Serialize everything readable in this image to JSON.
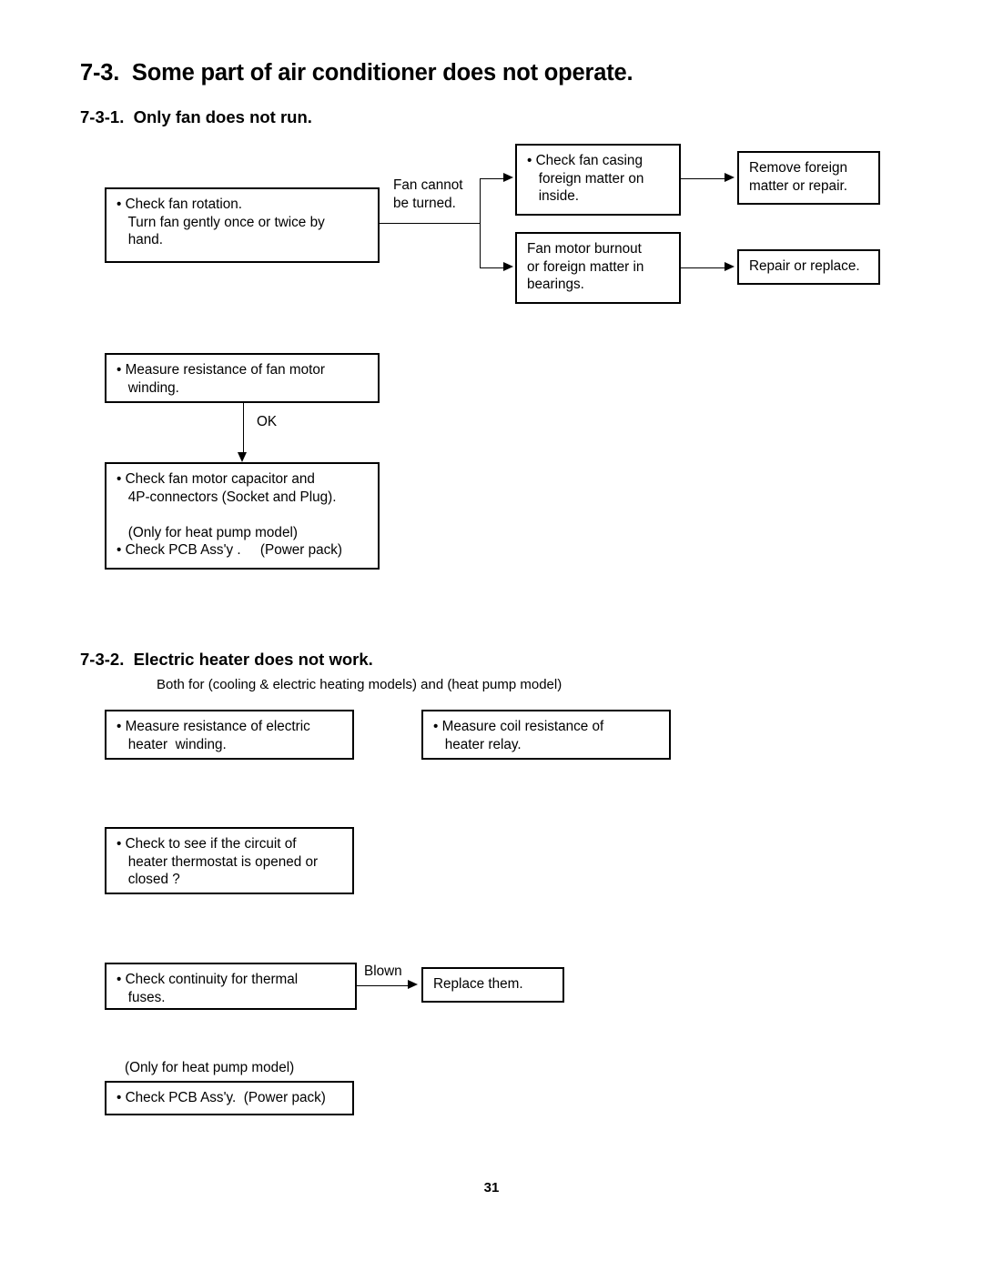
{
  "page": {
    "number": "31"
  },
  "section_main": {
    "number": "7-3.",
    "title": "Some part of air conditioner does not operate."
  },
  "section_1": {
    "number": "7-3-1.",
    "title": "Only fan does not run.",
    "boxes": {
      "check_fan_rotation": "• Check fan rotation.\n   Turn fan gently once or twice by\n   hand.",
      "check_fan_casing": "• Check fan casing\n   foreign matter on\n   inside.",
      "fan_motor_burnout": "Fan motor burnout\nor foreign matter in\nbearings.",
      "remove_foreign_matter": "Remove foreign\nmatter or repair.",
      "repair_or_replace": "Repair or replace.",
      "measure_resistance_fan_motor": "• Measure resistance of fan motor\n   winding.",
      "check_capacitor_connectors": "• Check fan motor capacitor and\n   4P-connectors (Socket and Plug).\n\n   (Only for heat pump model)\n• Check PCB Ass'y .     (Power pack)"
    },
    "labels": {
      "fan_cannot_be_turned": "Fan cannot\nbe turned.",
      "ok": "OK"
    }
  },
  "section_2": {
    "number": "7-3-2.",
    "title": "Electric heater does not work.",
    "note": "Both for (cooling & electric heating models) and (heat pump model)",
    "boxes": {
      "measure_resistance_heater": "• Measure resistance of electric\n   heater  winding.",
      "measure_coil_resistance_relay": "• Measure coil resistance of\n   heater relay.",
      "check_thermostat_circuit": "• Check to see if the circuit of\n   heater thermostat is opened or\n   closed ?",
      "check_continuity_thermal_fuses": "• Check continuity for thermal\n   fuses.",
      "replace_them": "Replace them.",
      "check_pcb_assy": "• Check PCB Ass'y.  (Power pack)"
    },
    "labels": {
      "blown": "Blown",
      "only_heat_pump": "(Only for heat pump model)"
    }
  },
  "colors": {
    "ink": "#000000",
    "paper": "#ffffff"
  }
}
